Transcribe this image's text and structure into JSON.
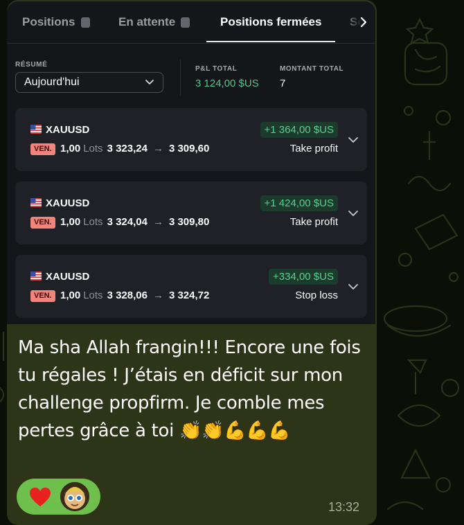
{
  "tabs": [
    {
      "label": "Positions"
    },
    {
      "label": "En attente"
    },
    {
      "label": "Positions fermées"
    },
    {
      "label": "So"
    }
  ],
  "summary": {
    "label": "RÉSUMÉ",
    "period": "Aujourd'hui",
    "pnl_label": "P&L TOTAL",
    "pnl_value": "3 124,00 $US",
    "amount_label": "MONTANT TOTAL",
    "amount_value": "7"
  },
  "trades": [
    {
      "symbol": "XAUUSD",
      "side": "VEN.",
      "qty": "1,00",
      "lots": "Lots",
      "open": "3 323,24",
      "close": "3 309,60",
      "pnl": "+1 364,00 $US",
      "reason": "Take profit"
    },
    {
      "symbol": "XAUUSD",
      "side": "VEN.",
      "qty": "1,00",
      "lots": "Lots",
      "open": "3 324,04",
      "close": "3 309,80",
      "pnl": "+1 424,00 $US",
      "reason": "Take profit"
    },
    {
      "symbol": "XAUUSD",
      "side": "VEN.",
      "qty": "1,00",
      "lots": "Lots",
      "open": "3 328,06",
      "close": "3 324,72",
      "pnl": "+334,00 $US",
      "reason": "Stop loss"
    }
  ],
  "message": {
    "text": "Ma sha Allah frangin!!! Encore une fois tu régales ! J’étais en déficit sur mon challenge propfirm. Je comble mes pertes grâce à toi 👏👏💪💪💪",
    "time": "13:32"
  },
  "reactions": [
    {
      "icon": "red-heart-icon"
    },
    {
      "icon": "avatar"
    }
  ],
  "colors": {
    "bubble": "#2e3418",
    "pnl_positive": "#56d08f",
    "sell_badge": "#f4837c",
    "reaction_pill": "#6fbf4c"
  }
}
